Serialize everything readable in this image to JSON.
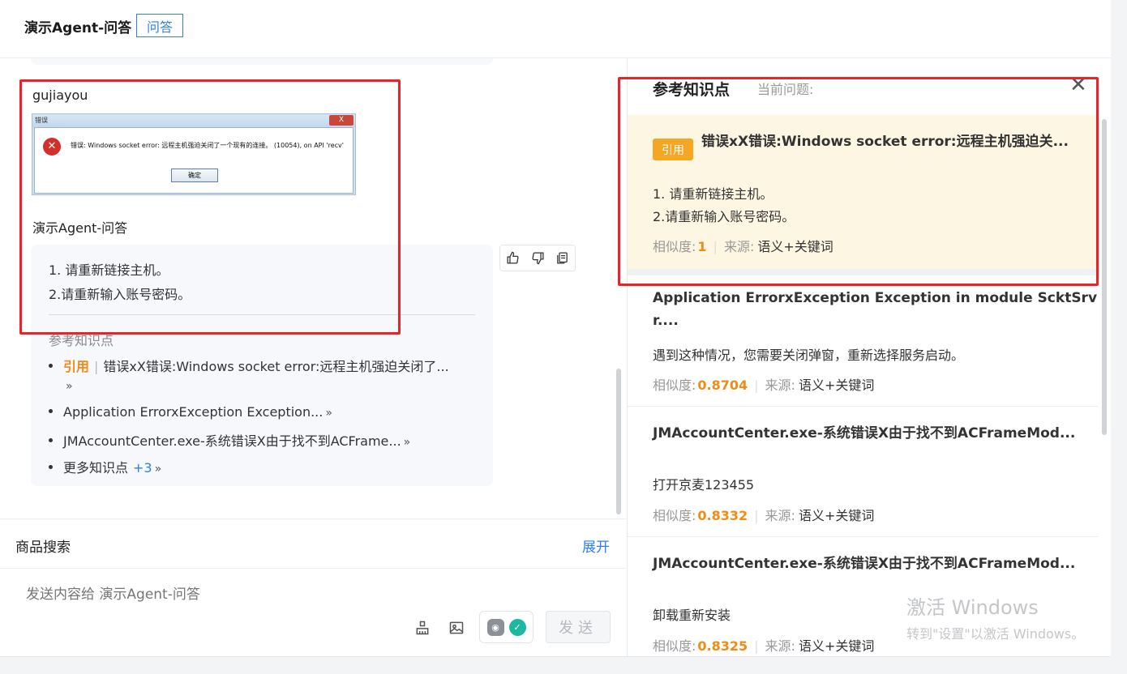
{
  "header": {
    "agent_title": "演示Agent-问答",
    "mode_tag": "问答"
  },
  "chat": {
    "user_name": "gujiayou",
    "screenshot": {
      "title": "错误",
      "close": "X",
      "message": "错误: Windows socket error: 远程主机强迫关闭了一个现有的连接。 (10054), on API 'recv'",
      "ok_button": "确定"
    },
    "bot_name": "演示Agent-问答",
    "answer_lines": [
      "1. 请重新链接主机。",
      "2.请重新输入账号密码。"
    ],
    "refs_heading": "参考知识点",
    "refs": [
      {
        "cite": "引用",
        "text": "错误xX错误:Windows socket error:远程主机强迫关闭了..."
      },
      {
        "text": "Application ErrorxException Exception..."
      },
      {
        "text": "JMAccountCenter.exe-系统错误X由于找不到ACFrame..."
      },
      {
        "text": "更多知识点",
        "count": "+3"
      }
    ],
    "actions": [
      "thumbs-up-icon",
      "thumbs-down-icon",
      "copy-icon"
    ]
  },
  "search": {
    "label": "商品搜索",
    "expand": "展开"
  },
  "input": {
    "placeholder": "发送内容给 演示Agent-问答",
    "send_label": "发送"
  },
  "panel": {
    "title": "参考知识点",
    "subtitle": "当前问题:",
    "similarity_label": "相似度:",
    "source_label": "来源:",
    "cards": [
      {
        "badge": "引用",
        "title": "错误xX错误:Windows socket error:远程主机强迫关...",
        "body_lines": [
          "1. 请重新链接主机。",
          "2.请重新输入账号密码。"
        ],
        "score": "1",
        "source": "语义+关键词"
      },
      {
        "title_lines": [
          "Application ErrorxException Exception in module ScktSrv",
          "r...."
        ],
        "body_lines": [
          "遇到这种情况，您需要关闭弹窗，重新选择服务启动。"
        ],
        "score": "0.8704",
        "source": "语义+关键词"
      },
      {
        "title": "JMAccountCenter.exe-系统错误X由于找不到ACFrameMod...",
        "body_lines": [
          "打开京麦123455"
        ],
        "score": "0.8332",
        "source": "语义+关键词"
      },
      {
        "title": "JMAccountCenter.exe-系统错误X由于找不到ACFrameMod...",
        "body_lines": [
          "卸载重新安装"
        ],
        "score": "0.8325",
        "source": "语义+关键词"
      }
    ]
  },
  "watermark": {
    "line1": "激活 Windows",
    "line2": "转到\"设置\"以激活 Windows。"
  },
  "colors": {
    "accent": "#2f7ff0",
    "cite": "#f28b14",
    "highlight": "#e8242b",
    "active_card": "#fdf6e3"
  }
}
